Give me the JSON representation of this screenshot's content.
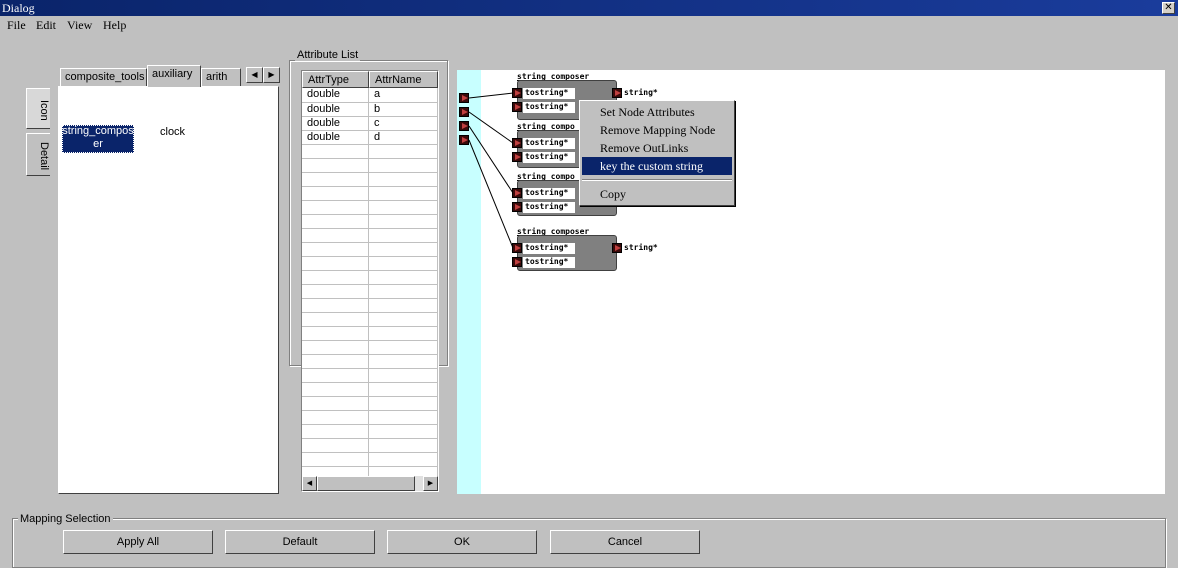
{
  "window": {
    "title": "Dialog"
  },
  "menu": [
    "File",
    "Edit",
    "View",
    "Help"
  ],
  "palette": {
    "tabs": [
      "composite_tools",
      "auxiliary",
      "arith"
    ],
    "active_tab": "auxiliary",
    "side_tabs": [
      "Icon",
      "Detail"
    ],
    "items": [
      {
        "label": "string_compos\ner",
        "selected": true
      },
      {
        "label": "clock",
        "selected": false
      }
    ]
  },
  "attributes": {
    "title": "Attribute List",
    "columns": [
      "AttrType",
      "AttrName"
    ],
    "rows": [
      [
        "double",
        "a"
      ],
      [
        "double",
        "b"
      ],
      [
        "double",
        "c"
      ],
      [
        "double",
        "d"
      ]
    ]
  },
  "canvas": {
    "nodes": [
      {
        "title": "string composer",
        "inputs": [
          "tostring*",
          "tostring*"
        ],
        "output": "string*"
      },
      {
        "title": "string compo",
        "inputs": [
          "tostring*",
          "tostring*"
        ],
        "output": ""
      },
      {
        "title": "string compo",
        "inputs": [
          "tostring*",
          "tostring*"
        ],
        "output": ""
      },
      {
        "title": "string composer",
        "inputs": [
          "tostring*",
          "tostring*"
        ],
        "output": "string*"
      }
    ],
    "context_menu": {
      "items": [
        "Set Node Attributes",
        "Remove Mapping Node",
        "Remove OutLinks",
        "key the custom string",
        "Copy"
      ],
      "highlighted": "key the custom string"
    }
  },
  "mapping": {
    "title": "Mapping Selection",
    "buttons": [
      "Apply All",
      "Default",
      "OK",
      "Cancel"
    ]
  },
  "colors": {
    "titlebar": "#0a246a",
    "selection": "#0a246a",
    "canvas_strip": "#c8ffff"
  }
}
